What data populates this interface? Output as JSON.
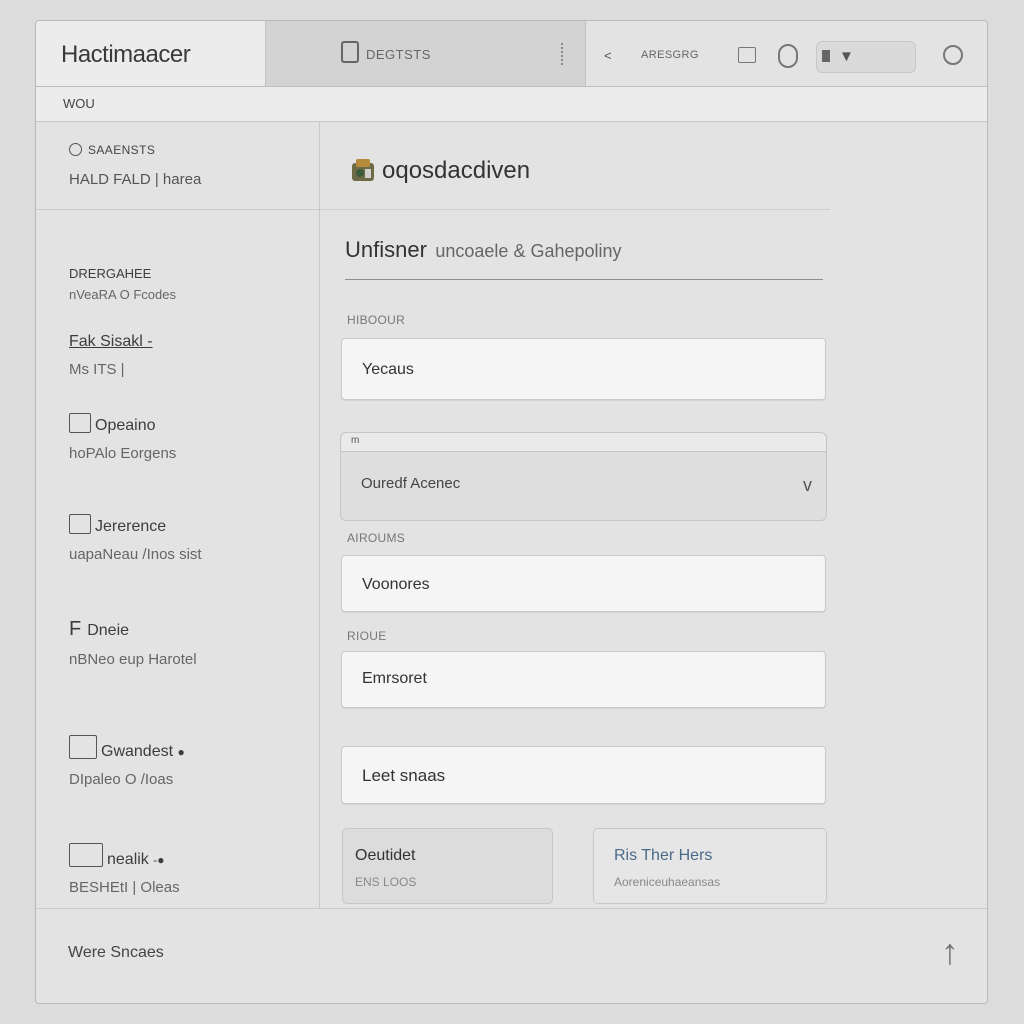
{
  "app": {
    "title": "Hactimaacer"
  },
  "toolbar": {
    "tab_label": "DEGTSTS",
    "back_label": "<",
    "location": "ARESGRG"
  },
  "breadcrumb": {
    "label": "WOU"
  },
  "sidebar": {
    "header": {
      "title": "SAAENSTS",
      "subtitle": "HALD FALD | harea"
    },
    "items": [
      {
        "title": "DRERGAHEE",
        "subtitle": "nVeaRA O Fcodes"
      },
      {
        "title": "Fak Sisakl -",
        "subtitle": "Ms ITS |"
      },
      {
        "title": "Opeaino",
        "subtitle": "hoPAlo Eorgens"
      },
      {
        "title": "Jererence",
        "subtitle": "uapaNeau /Inos sist"
      },
      {
        "title": "Dneie",
        "subtitle": "nBNeo eup Harotel"
      },
      {
        "title": "Gwandest",
        "subtitle": "DIpaleo O /Ioas"
      },
      {
        "title": "nealik",
        "subtitle": "BESHEtI | Oleas"
      }
    ]
  },
  "main": {
    "page_title": "oqosdacdiven",
    "section_head_strong": "Unfisner",
    "section_head_rest": "uncoaele & Gahepoliny",
    "fields": [
      {
        "label": "HIBOOUR",
        "value": "Yecaus"
      },
      {
        "label": "AIROUMS",
        "value": "Voonores"
      },
      {
        "label": "RIOUE",
        "value": "Emrsoret"
      },
      {
        "label": "",
        "value": "Leet snaas"
      }
    ],
    "select": {
      "tab_label": "m",
      "value": "Ouredf Acenec",
      "chevron": "v"
    },
    "cards": [
      {
        "title": "Oeutidet",
        "subtitle": "ENS LOOS"
      },
      {
        "title": "Ris Ther Hers",
        "subtitle": "Aoreniceuhaeansas"
      }
    ]
  },
  "footer": {
    "label": "Were Sncaes",
    "up_arrow": "↑"
  },
  "colors": {
    "accent_link": "#4a6a8a",
    "background": "#dcdcdc",
    "panel": "#e3e3e3"
  }
}
